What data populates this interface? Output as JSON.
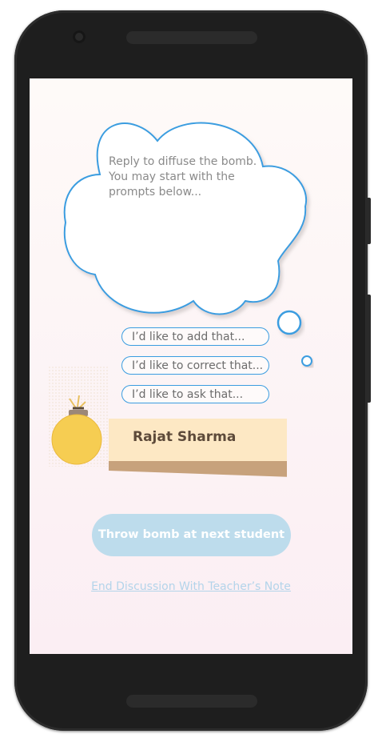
{
  "cloud": {
    "text": "Reply to diffuse the bomb. You may start with the prompts below..."
  },
  "prompts": [
    {
      "label": "I’d like to add that..."
    },
    {
      "label": "I’d like to correct that..."
    },
    {
      "label": "I’d like to ask that..."
    }
  ],
  "student": {
    "name": "Rajat Sharma"
  },
  "actions": {
    "throw_label": "Throw bomb at next student",
    "end_label": "End Discussion With Teacher’s Note"
  },
  "icons": {
    "bomb": "bomb-icon",
    "thought": "thought-bubble-icon"
  },
  "colors": {
    "bubble_outline": "#3b9de0",
    "bomb": "#f6cd52",
    "name_card": "#fde8c4",
    "button": "#bddcec",
    "link": "#b3d4ea"
  }
}
